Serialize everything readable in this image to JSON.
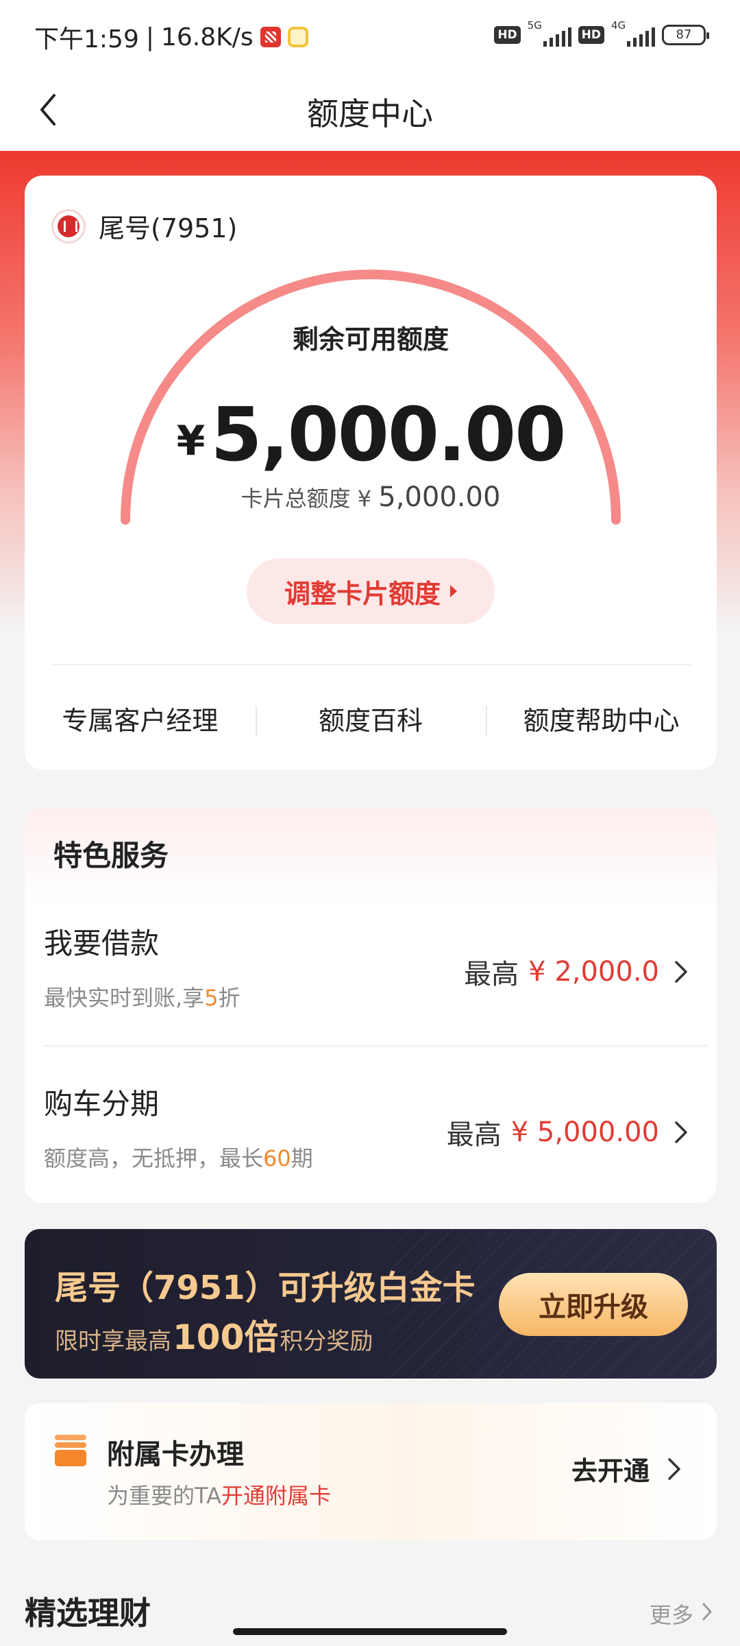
{
  "status_bar": {
    "time": "下午1:59",
    "speed": "16.8K/s",
    "hd1": "HD",
    "net1": "5G",
    "hd2": "HD",
    "net2": "4G",
    "battery": "87"
  },
  "nav": {
    "title": "额度中心",
    "back_icon": "chevron-left-icon"
  },
  "credit": {
    "card_tail": "尾号(7951)",
    "remaining_label": "剩余可用额度",
    "currency": "¥",
    "remaining_amount": "5,000.00",
    "total_label": "卡片总额度 ¥",
    "total_amount": "5,000.00",
    "gauge_level": 1.0,
    "adjust_button": "调整卡片额度",
    "links": [
      "专属客户经理",
      "额度百科",
      "额度帮助中心"
    ]
  },
  "features": {
    "title": "特色服务",
    "items": [
      {
        "name": "我要借款",
        "desc_prefix": "最快实时到账,享",
        "desc_highlight": "5",
        "desc_suffix": "折",
        "max_label": "最高",
        "max_amount": "¥ 2,000.0"
      },
      {
        "name": "购车分期",
        "desc_prefix": "额度高，无抵押，最长",
        "desc_highlight": "60",
        "desc_suffix": "期",
        "max_label": "最高",
        "max_amount": "¥ 5,000.00"
      }
    ]
  },
  "upgrade": {
    "title": "尾号（7951）可升级白金卡",
    "sub_prefix": "限时享最高",
    "sub_highlight": "100倍",
    "sub_suffix": "积分奖励",
    "button": "立即升级"
  },
  "supplementary": {
    "title": "附属卡办理",
    "sub_prefix": "为重要的TA",
    "sub_highlight": "开通附属卡",
    "action": "去开通"
  },
  "section": {
    "title": "精选理财",
    "more": "更多"
  },
  "colors": {
    "brand_red": "#e23b33",
    "gauge": "#f58a88",
    "highlight_orange": "#f08a2c",
    "gold": "#f6c98f"
  }
}
